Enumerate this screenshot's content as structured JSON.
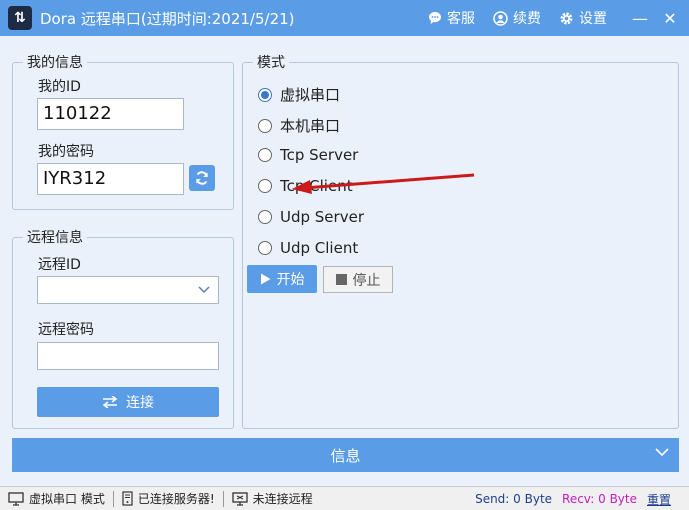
{
  "window": {
    "title": "Dora 远程串口(过期时间:2021/5/21)",
    "app_icon": "⇅"
  },
  "titlebar": {
    "service": "客服",
    "renew": "续费",
    "settings": "设置",
    "minimize": "—",
    "close": "✕"
  },
  "my_info": {
    "legend": "我的信息",
    "id_label": "我的ID",
    "id_value": "110122",
    "password_label": "我的密码",
    "password_value": "IYR312"
  },
  "remote_info": {
    "legend": "远程信息",
    "id_label": "远程ID",
    "id_value": "",
    "password_label": "远程密码",
    "password_value": "",
    "connect": "连接"
  },
  "mode": {
    "legend": "模式",
    "options": [
      {
        "label": "虚拟串口",
        "selected": true
      },
      {
        "label": "本机串口",
        "selected": false
      },
      {
        "label": "Tcp Server",
        "selected": false
      },
      {
        "label": "Tcp Client",
        "selected": false
      },
      {
        "label": "Udp Server",
        "selected": false
      },
      {
        "label": "Udp Client",
        "selected": false
      }
    ],
    "start": "开始",
    "stop": "停止"
  },
  "info_bar": {
    "label": "信息"
  },
  "status": {
    "mode": "虚拟串口 模式",
    "server": "已连接服务器!",
    "remote": "未连接远程",
    "send": "Send: 0 Byte",
    "recv": "Recv: 0 Byte",
    "reset": "重置"
  },
  "colors": {
    "accent": "#5a9ce6",
    "recv": "#c020c0",
    "arrow": "#cc1a1a"
  }
}
